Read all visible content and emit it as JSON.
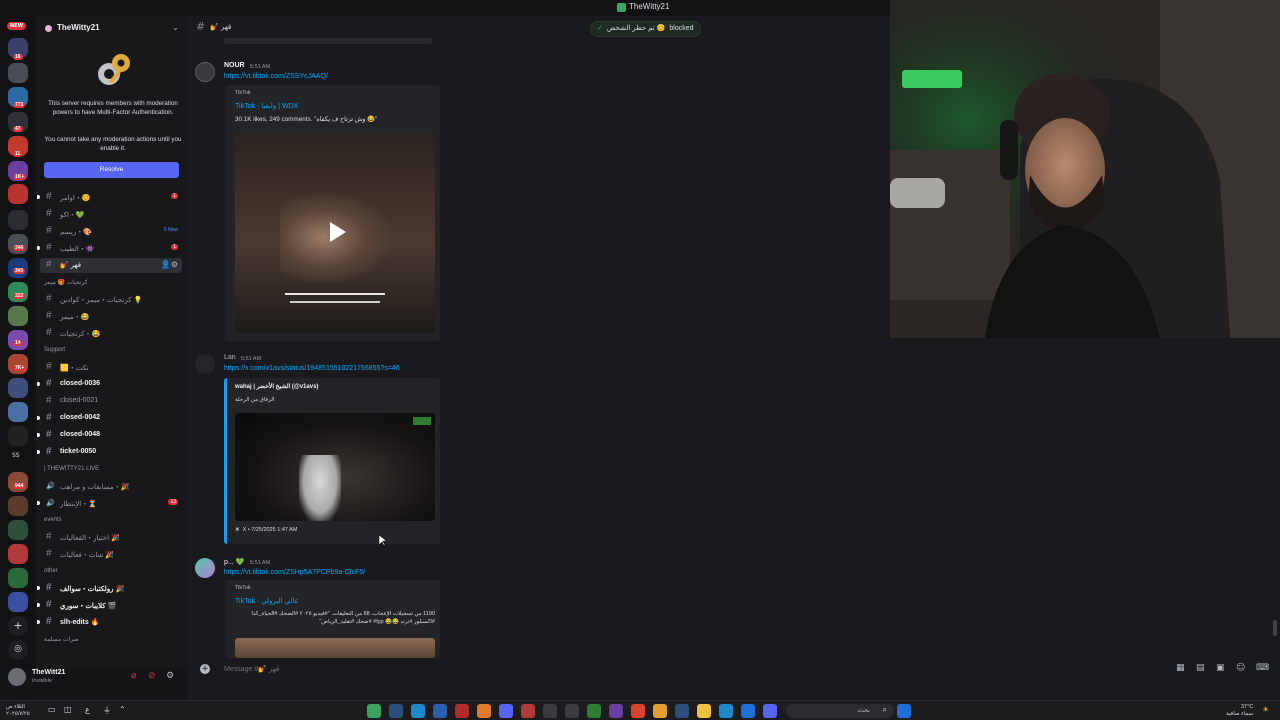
{
  "window": {
    "title": "TheWitty21"
  },
  "rail": {
    "new_label": "NEW",
    "badges": [
      "16",
      "773",
      "47",
      "11",
      "1K+",
      "9",
      "246",
      "345",
      "222",
      "14",
      "7K+",
      "5",
      "944",
      "5",
      "3",
      "5",
      "10"
    ],
    "rail_text": "SS"
  },
  "guild": {
    "name": "TheWitty21"
  },
  "mfa": {
    "message": "This server requires members with moderation powers to have Multi-Factor Authentication.",
    "note": "You cannot take any moderation actions until you enable it.",
    "resolve_label": "Resolve"
  },
  "channels": [
    {
      "label": "اوامر・😊",
      "count": "1",
      "type": "text"
    },
    {
      "label": "اكو・💚",
      "type": "text"
    },
    {
      "label": "ريسم・🎨",
      "new": "5 New",
      "type": "text"
    },
    {
      "label": "الطيب・👾",
      "count": "1",
      "type": "text"
    },
    {
      "label": "💅 قهر",
      "type": "text",
      "active": true
    },
    {
      "category": "كرنجيات 🎁 ميمز"
    },
    {
      "label": "كرنجيات・ميمز・كوادين 💡",
      "type": "text"
    },
    {
      "label": "ميمز・😂",
      "type": "text"
    },
    {
      "label": "كرنجيات・😂",
      "type": "text"
    },
    {
      "category": "Support"
    },
    {
      "label": "🟨・تكت",
      "type": "text"
    },
    {
      "label": "closed-0036",
      "type": "text",
      "bright": true
    },
    {
      "label": "closed-0021",
      "type": "text"
    },
    {
      "label": "closed-0042",
      "type": "text",
      "bright": true
    },
    {
      "label": "closed-0048",
      "type": "text",
      "bright": true
    },
    {
      "label": "ticket-0050",
      "type": "text",
      "bright": true
    },
    {
      "category": "| THEWITTY21 LIVE"
    },
    {
      "label": "مسابقات و مراهب・🎉",
      "type": "voice"
    },
    {
      "label": "الإنتظار・⏳",
      "count": "13",
      "type": "voice"
    },
    {
      "category": "events"
    },
    {
      "label": "اختيار・الفعاليات 🎉",
      "type": "text"
    },
    {
      "label": "شات・فعاليات 🎉",
      "type": "text"
    },
    {
      "category": "other"
    },
    {
      "label": "رولكتبات・سوالف 🎉",
      "type": "text",
      "bright": true
    },
    {
      "label": "كلايبات・سوري 🎬",
      "type": "text",
      "bright": true
    },
    {
      "label": "slh-edits 🔥",
      "type": "text",
      "bright": true
    },
    {
      "category": "صرات مسلمة"
    }
  ],
  "header": {
    "channel": "💅 قهر"
  },
  "notice": {
    "text": "تم حظر الشخص 😊",
    "blocked": "blocked"
  },
  "messages": [
    {
      "author": "NOUR",
      "time": "5:51 AM",
      "link": "https://vt.tiktok.com/ZSSYcJAAQ/",
      "embed": {
        "provider": "TikTok",
        "title": "TikTok · وايفيا | WDX",
        "desc": "30.1K likes, 249 comments. \"وش ترتاح ف يكفاه 😂\""
      }
    },
    {
      "author": "Lan",
      "time": "5:51 AM",
      "link": "https://x.com/v1avs/status/1948515510221766855?s=46",
      "embed": {
        "provider": "wahaj | الشيخ الأخضر (@v1avs)",
        "desc": "الرفاق من الرحلة",
        "footer": "X • 7/25/2025 1:47 AM"
      }
    },
    {
      "author": "p... 💚",
      "time": "5:51 AM",
      "link": "https://vt.tiktok.com/ZSHp5A7PCPb9a-GlcF5/",
      "embed": {
        "provider": "TikTok",
        "title": "TikTok · عالي البرولي",
        "desc": "1190 من تسجيلات الإعجاب، 68 من التعليقات. \"#فيديو ٢٠٢٥ #الضحك #الحياة_كذا #اكسبلور #ترند 😂😂 fyp# #ضحك #تقليد_الرياض\""
      }
    }
  ],
  "composer": {
    "placeholder": "Message #💅 قهر"
  },
  "user": {
    "name": "TheWitt21",
    "status": "Invisible"
  },
  "taskbar": {
    "search_label": "بحث",
    "time": "03:47 م",
    "date": "٢٠٢٥/٧/٢٥",
    "weather": "37°C",
    "weather_note": "سماء صافية",
    "left_time": "الثلاء ص",
    "left_date": "٢٠٢٥/٧/٢٥",
    "lang": "ع"
  },
  "colors": {
    "accent": "#5865f2",
    "link": "#00a8fc",
    "danger": "#da373c",
    "online": "#3ba55d"
  }
}
